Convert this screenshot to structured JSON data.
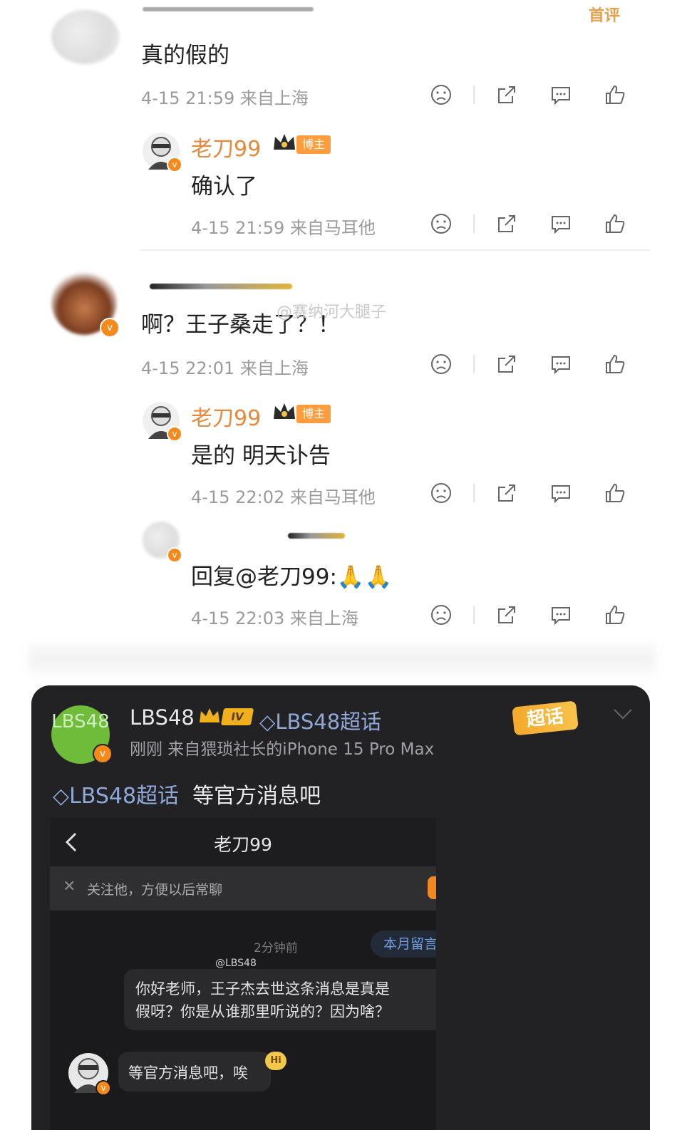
{
  "top_corner_badge": "首评",
  "comments": [
    {
      "text": "真的假的",
      "meta": "4-15 21:59 来自上海"
    },
    {
      "reply_author": "老刀99",
      "reply_tag": "博主",
      "reply_text": "确认了",
      "reply_meta": "4-15 21:59 来自马耳他"
    },
    {
      "text": "啊？王子桑走了？！",
      "meta": "4-15 22:01 来自上海",
      "watermark": "@赛纳河大腿子"
    },
    {
      "reply_author": "老刀99",
      "reply_tag": "博主",
      "reply_text": "是的 明天讣告",
      "reply_meta": "4-15 22:02 来自马耳他"
    },
    {
      "reply_text": "回复@老刀99:🙏🙏",
      "reply_meta": "4-15 22:03 来自上海"
    }
  ],
  "post": {
    "author": "LBS48",
    "level_tag": "IV",
    "supertopic": "LBS48超话",
    "meta": "刚刚  来自猥琐社长的iPhone 15 Pro Max",
    "avatar_text": "LBS48",
    "badge": "超话",
    "topic_link": "LBS48超话",
    "text": "等官方消息吧"
  },
  "chat": {
    "title": "老刀99",
    "follow_hint": "关注他，方便以后常聊",
    "time": "2分钟前",
    "month_button": "本月留言",
    "watermark": "@LBS48",
    "msg_right": "你好老师，王子杰去世这条消息是真是\n假呀？你是从谁那里听说的？因为啥？",
    "msg_left": "等官方消息吧，唉",
    "hi_badge": "Hi"
  },
  "colors": {
    "orange": "#e8893a",
    "meta_gray": "#9a9a9a",
    "card_bg": "#222225",
    "topic_blue": "#8ea8d8"
  }
}
